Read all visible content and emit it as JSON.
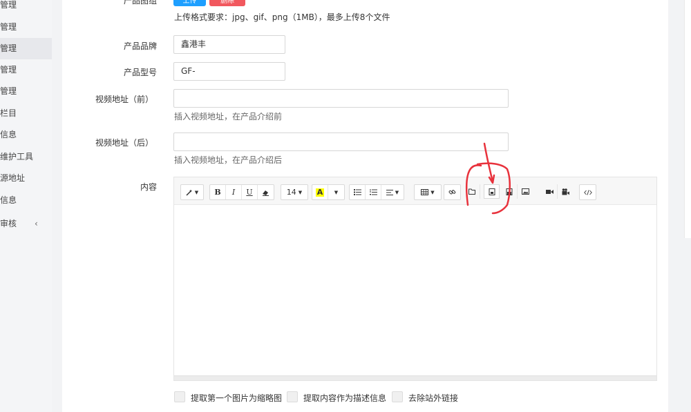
{
  "sidebar": {
    "items": [
      {
        "label": "管理",
        "active": false
      },
      {
        "label": "管理",
        "active": false
      },
      {
        "label": "管理",
        "active": true
      },
      {
        "label": "管理",
        "active": false
      },
      {
        "label": "管理",
        "active": false
      },
      {
        "label": "栏目",
        "active": false
      },
      {
        "label": "信息",
        "active": false
      },
      {
        "label": "维护工具",
        "active": false
      },
      {
        "label": "源地址",
        "active": false
      },
      {
        "label": "信息",
        "active": false
      },
      {
        "label": "审核",
        "active": false
      }
    ],
    "caret": "‹"
  },
  "form": {
    "gallery": {
      "label": "产品图组",
      "upload_label": "上传",
      "delete_label": "删除",
      "hint": "上传格式要求：jpg、gif、png（1MB），最多上传8个文件"
    },
    "brand": {
      "label": "产品品牌",
      "value": "鑫港丰"
    },
    "model": {
      "label": "产品型号",
      "value": "GF-"
    },
    "video_before": {
      "label": "视频地址（前）",
      "value": "",
      "hint": "插入视频地址，在产品介绍前"
    },
    "video_after": {
      "label": "视频地址（后）",
      "value": "",
      "hint": "插入视频地址，在产品介绍后"
    },
    "content": {
      "label": "内容"
    }
  },
  "editor": {
    "font_size": "14",
    "bold": "B",
    "italic": "I",
    "underline": "U",
    "color_letter": "A",
    "highlight_color": "#ffff00"
  },
  "options": [
    {
      "label": "提取第一个图片为缩略图"
    },
    {
      "label": "提取内容作为描述信息"
    },
    {
      "label": "去除站外链接"
    }
  ],
  "colors": {
    "upload": "#1e9fff",
    "delete": "#f1585e",
    "annotation": "#e8323c"
  }
}
